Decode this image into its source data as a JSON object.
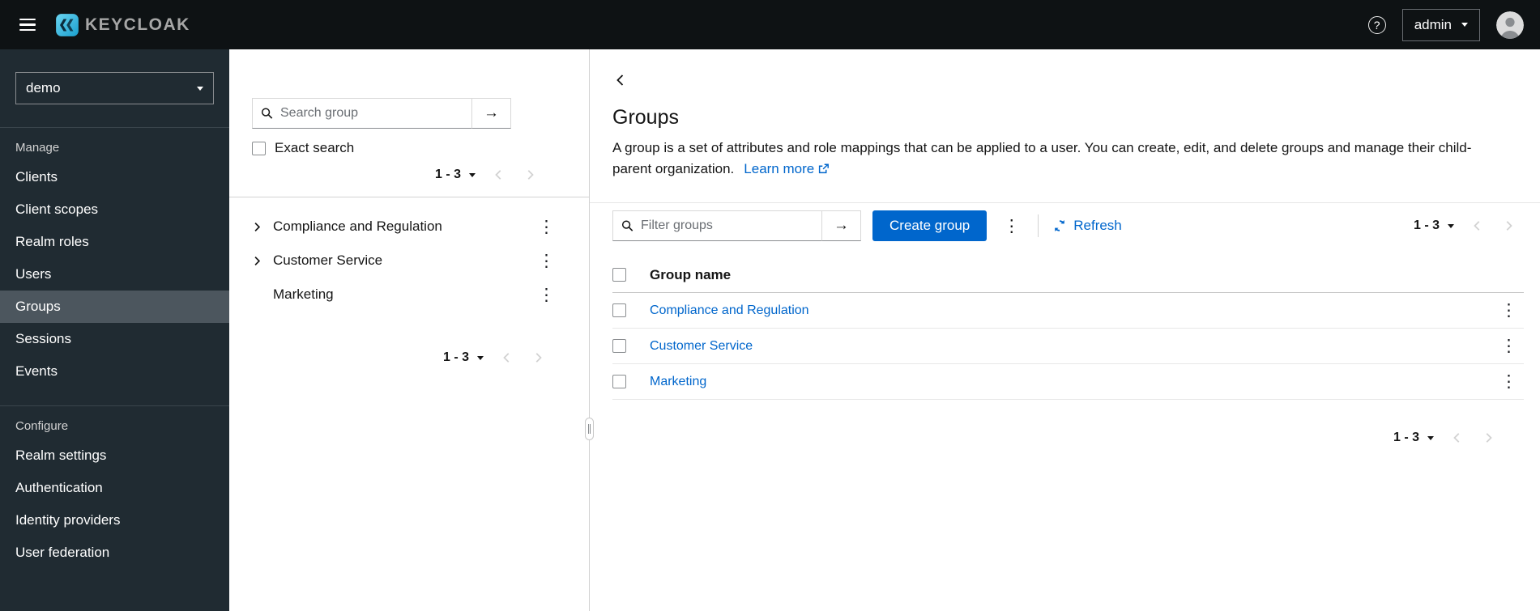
{
  "topbar": {
    "brand": "KEYCLOAK",
    "user_menu_label": "admin"
  },
  "sidebar": {
    "realm_selector": "demo",
    "selected_item": "Groups",
    "sections": [
      {
        "label": "Manage",
        "items": [
          "Clients",
          "Client scopes",
          "Realm roles",
          "Users",
          "Groups",
          "Sessions",
          "Events"
        ]
      },
      {
        "label": "Configure",
        "items": [
          "Realm settings",
          "Authentication",
          "Identity providers",
          "User federation"
        ]
      }
    ]
  },
  "tree_panel": {
    "search_placeholder": "Search group",
    "exact_search_label": "Exact search",
    "pagination_top": "1 - 3",
    "pagination_bottom": "1 - 3",
    "groups": [
      {
        "name": "Compliance and Regulation",
        "expandable": true
      },
      {
        "name": "Customer Service",
        "expandable": true
      },
      {
        "name": "Marketing",
        "expandable": false
      }
    ]
  },
  "main": {
    "title": "Groups",
    "description": "A group is a set of attributes and role mappings that can be applied to a user. You can create, edit, and delete groups and manage their child-parent organization.",
    "learn_more_label": "Learn more",
    "toolbar": {
      "filter_placeholder": "Filter groups",
      "create_button_label": "Create group",
      "refresh_label": "Refresh",
      "pagination": "1 - 3"
    },
    "table": {
      "column_header": "Group name",
      "rows": [
        {
          "name": "Compliance and Regulation"
        },
        {
          "name": "Customer Service"
        },
        {
          "name": "Marketing"
        }
      ]
    },
    "pagination_bottom": "1 - 3"
  },
  "colors": {
    "accent_blue": "#0066cc",
    "link_blue": "#0066cc",
    "topbar_bg": "#0e1214",
    "sidebar_bg": "#202b32",
    "sidebar_selected_bg": "#4c565e"
  }
}
